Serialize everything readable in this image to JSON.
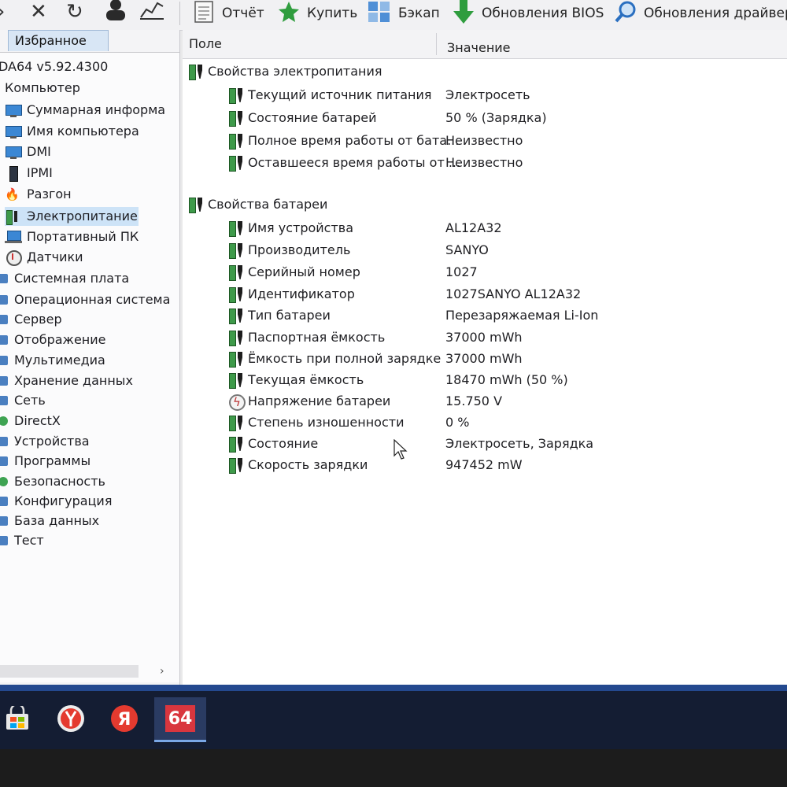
{
  "toolbar": {
    "report_label": "Отчёт",
    "buy_label": "Купить",
    "backup_label": "Бэкап",
    "bios_updates_label": "Обновления BIOS",
    "driver_updates_label": "Обновления драйверо"
  },
  "left_panel": {
    "favorites_tab": "Избранное",
    "app_version": "DA64 v5.92.4300",
    "tree": [
      {
        "label": "Компьютер",
        "icon": "none",
        "expanded": true
      },
      {
        "label": "Суммарная информа",
        "icon": "monitor-icon"
      },
      {
        "label": "Имя компьютера",
        "icon": "monitor-icon"
      },
      {
        "label": "DMI",
        "icon": "monitor-icon"
      },
      {
        "label": "IPMI",
        "icon": "server-icon"
      },
      {
        "label": "Разгон",
        "icon": "flame-icon"
      },
      {
        "label": "Электропитание",
        "icon": "battery-icon",
        "selected": true
      },
      {
        "label": "Портативный ПК",
        "icon": "laptop-icon"
      },
      {
        "label": "Датчики",
        "icon": "gauge-icon"
      },
      {
        "label": "Системная плата"
      },
      {
        "label": "Операционная система"
      },
      {
        "label": "Сервер"
      },
      {
        "label": "Отображение"
      },
      {
        "label": "Мультимедиа"
      },
      {
        "label": "Хранение данных"
      },
      {
        "label": "Сеть"
      },
      {
        "label": "DirectX"
      },
      {
        "label": "Устройства"
      },
      {
        "label": "Программы"
      },
      {
        "label": "Безопасность"
      },
      {
        "label": "Конфигурация"
      },
      {
        "label": "База данных"
      },
      {
        "label": "Тест"
      }
    ]
  },
  "main": {
    "column_field": "Поле",
    "column_value": "Значение",
    "power_section": {
      "title": "Свойства электропитания",
      "rows": [
        {
          "field": "Текущий источник питания",
          "value": "Электросеть"
        },
        {
          "field": "Состояние батарей",
          "value": "50 % (Зарядка)"
        },
        {
          "field": "Полное время работы от бата...",
          "value": "Неизвестно"
        },
        {
          "field": "Оставшееся время работы от ...",
          "value": "Неизвестно"
        }
      ]
    },
    "battery_section": {
      "title": "Свойства батареи",
      "rows": [
        {
          "field": "Имя устройства",
          "value": "AL12A32"
        },
        {
          "field": "Производитель",
          "value": "SANYO"
        },
        {
          "field": "Серийный номер",
          "value": "1027"
        },
        {
          "field": "Идентификатор",
          "value": "1027SANYO AL12A32"
        },
        {
          "field": "Тип батареи",
          "value": "Перезаряжаемая Li-Ion"
        },
        {
          "field": "Паспортная ёмкость",
          "value": "37000 mWh"
        },
        {
          "field": "Ёмкость при полной зарядке",
          "value": "37000 mWh"
        },
        {
          "field": "Текущая ёмкость",
          "value": "18470 mWh  (50 %)"
        },
        {
          "field": "Напряжение батареи",
          "value": "15.750 V",
          "icon": "voltage-icon"
        },
        {
          "field": "Степень изношенности",
          "value": "0 %"
        },
        {
          "field": "Состояние",
          "value": "Электросеть, Зарядка"
        },
        {
          "field": "Скорость зарядки",
          "value": "947452 mW"
        }
      ]
    }
  },
  "taskbar": {
    "aida_label": "64"
  },
  "colors": {
    "taskbar_bg": "#141d33",
    "taskbar_accent": "#24498f",
    "selection_bg": "#cde3f7",
    "battery_green": "#3e9a4a"
  }
}
